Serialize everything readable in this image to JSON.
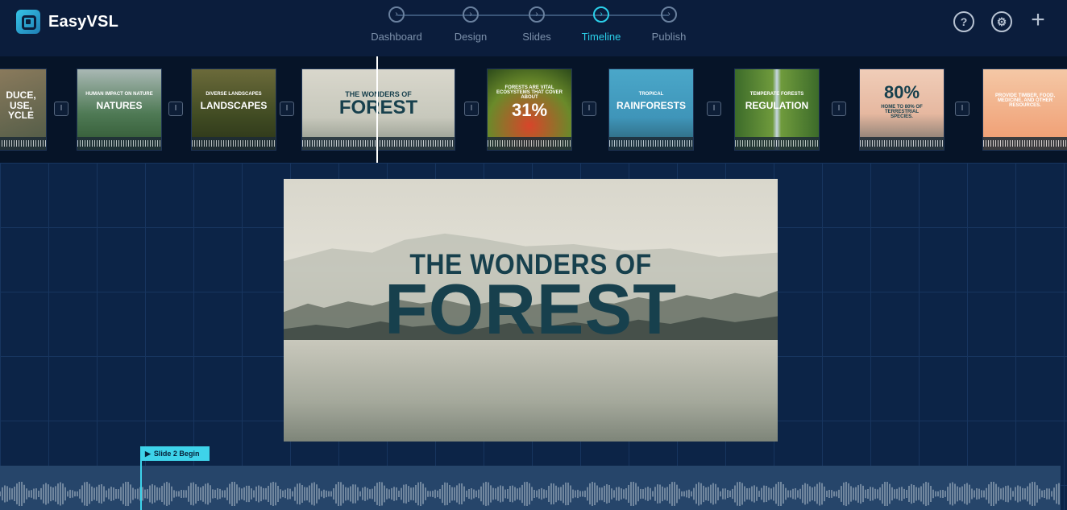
{
  "app": {
    "name": "EasyVSL"
  },
  "steps": [
    {
      "label": "Dashboard",
      "active": false
    },
    {
      "label": "Design",
      "active": false
    },
    {
      "label": "Slides",
      "active": false
    },
    {
      "label": "Timeline",
      "active": true
    },
    {
      "label": "Publish",
      "active": false
    }
  ],
  "header_icons": [
    "help-icon",
    "settings-icon",
    "plus-icon"
  ],
  "slides": [
    {
      "small": "",
      "big": "DUCE, USE, YCLE"
    },
    {
      "small": "HUMAN IMPACT ON NATURE",
      "big": "NATURES"
    },
    {
      "small": "DIVERSE LANDSCAPES",
      "big": "LANDSCAPES"
    },
    {
      "small": "THE WONDERS OF",
      "big": "FOREST"
    },
    {
      "small": "FORESTS ARE VITAL ECOSYSTEMS THAT COVER ABOUT",
      "big": "31%"
    },
    {
      "small": "TROPICAL",
      "big": "RAINFORESTS"
    },
    {
      "small": "TEMPERATE FORESTS",
      "big": "REGULATION"
    },
    {
      "small": "HOME TO 80% OF TERRESTRIAL SPECIES.",
      "big": "80%"
    },
    {
      "small": "PROVIDE TIMBER, FOOD, MEDICINE, AND OTHER RESOURCES.",
      "big": ""
    }
  ],
  "main_slide": {
    "subtitle": "THE WONDERS OF",
    "title": "FOREST"
  },
  "timeline": {
    "marker_label": "Slide 2 Begin"
  },
  "colors": {
    "accent": "#2bd0ea",
    "background": "#0a1d3a",
    "slide_text": "#17404d"
  }
}
